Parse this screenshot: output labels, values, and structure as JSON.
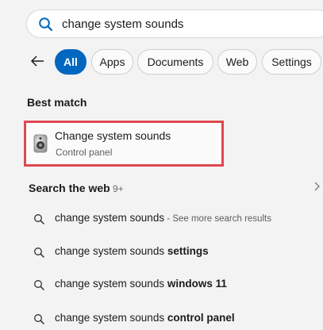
{
  "search": {
    "query": "change system sounds"
  },
  "filters": [
    "All",
    "Apps",
    "Documents",
    "Web",
    "Settings"
  ],
  "best_match": {
    "heading": "Best match",
    "title": "Change system sounds",
    "subtitle": "Control panel"
  },
  "web": {
    "heading": "Search the web",
    "count": "9+",
    "results": [
      {
        "text": "change system sounds",
        "bold": "",
        "suffix": " - See more search results"
      },
      {
        "text": "change system sounds ",
        "bold": "settings",
        "suffix": ""
      },
      {
        "text": "change system sounds ",
        "bold": "windows 11",
        "suffix": ""
      },
      {
        "text": "change system sounds ",
        "bold": "control panel",
        "suffix": ""
      }
    ]
  },
  "colors": {
    "accent": "#0067c0",
    "highlight_border": "#e04850"
  },
  "icons": [
    "search-icon",
    "back-arrow-icon",
    "speaker-icon",
    "chevron-right-icon",
    "magnifier-icon"
  ]
}
